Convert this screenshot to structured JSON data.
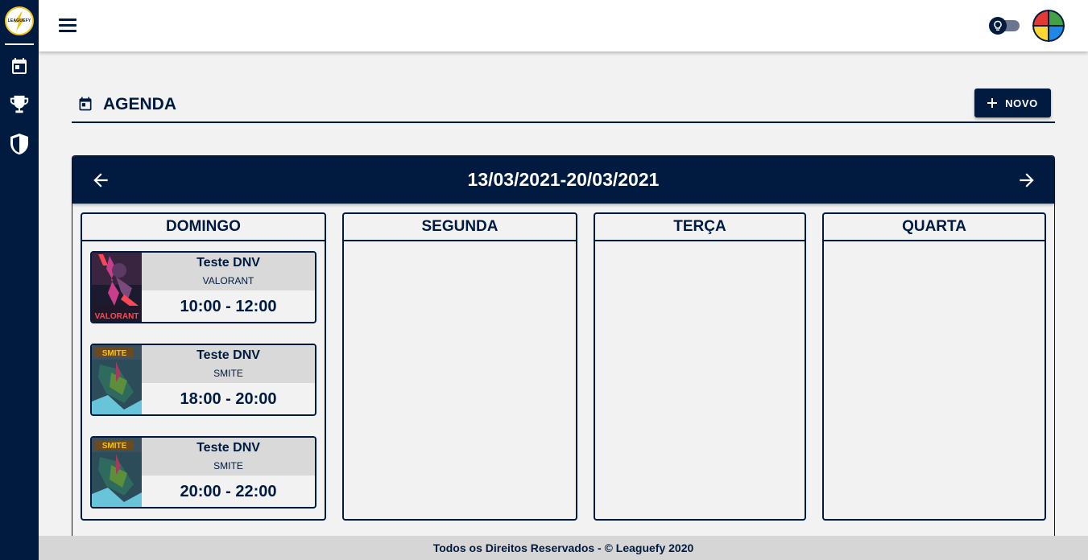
{
  "sidebar": {
    "logo_text": "LEAGUEFY",
    "items": [
      {
        "icon": "calendar-icon"
      },
      {
        "icon": "trophy-icon"
      },
      {
        "icon": "shield-icon"
      }
    ]
  },
  "topbar": {
    "menu_icon": "menu-icon",
    "theme_toggle_icon": "lightbulb-icon",
    "avatar_colors": [
      "#e53935",
      "#43a047",
      "#fdd835",
      "#1e88e5"
    ]
  },
  "page": {
    "title": "AGENDA",
    "new_button_label": "NOVO"
  },
  "calendar": {
    "week_range": "13/03/2021-20/03/2021",
    "days": [
      {
        "name": "DOMINGO",
        "events": [
          {
            "title": "Teste DNV",
            "game": "VALORANT",
            "time": "10:00 - 12:00",
            "thumb_label": "VALORANT"
          },
          {
            "title": "Teste DNV",
            "game": "SMITE",
            "time": "18:00 - 20:00",
            "thumb_label": "SMITE"
          },
          {
            "title": "Teste DNV",
            "game": "SMITE",
            "time": "20:00 - 22:00",
            "thumb_label": "SMITE"
          }
        ]
      },
      {
        "name": "SEGUNDA",
        "events": []
      },
      {
        "name": "TERÇA",
        "events": []
      },
      {
        "name": "QUARTA",
        "events": []
      }
    ]
  },
  "footer": {
    "text": "Todos os Direitos Reservados -  © Leaguefy 2020"
  },
  "colors": {
    "primary": "#001a40",
    "background": "#f2f2f2",
    "card_header": "#d9d9d9",
    "footer": "#d6d6d6",
    "logo_accent": "#f2c21b"
  }
}
